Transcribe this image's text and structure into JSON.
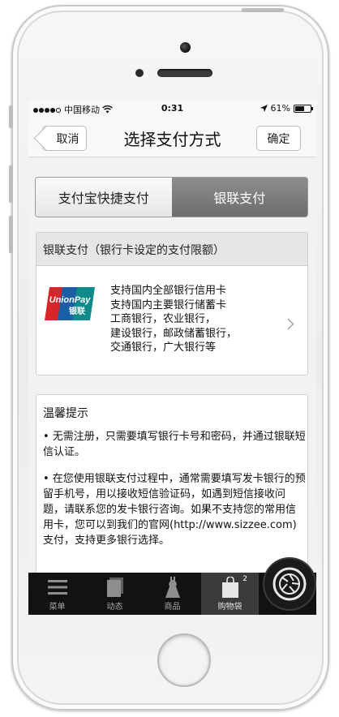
{
  "status_bar": {
    "carrier": "中国移动",
    "time": "0:31",
    "battery": "61%",
    "battery_level": 0.61
  },
  "nav": {
    "back_label": "取消",
    "title": "选择支付方式",
    "confirm_label": "确定"
  },
  "payment_tabs": [
    {
      "label": "支付宝快捷支付",
      "selected": false
    },
    {
      "label": "银联支付",
      "selected": true
    }
  ],
  "unionpay_card": {
    "header": "银联支付（银行卡设定的支付限额）",
    "logo_text": "UnionPay",
    "logo_text_cn": "银联",
    "lines": [
      "支持国内全部银行信用卡",
      "支持国内主要银行储蓄卡",
      "工商银行，农业银行，",
      "建设银行，邮政储蓄银行，",
      "交通银行，广大银行等"
    ]
  },
  "tips": {
    "title": "温馨提示",
    "paragraphs": [
      "• 无需注册，只需要填写银行卡号和密码，并通过银联短信认证。",
      "• 在您使用银联支付过程中，通常需要填写发卡银行的预留手机号，用以接收短信验证码，如遇到短信接收问题，请联系您的发卡银行咨询。如果不支持您的常用信用卡，您可以到我们的官网(http://www.sizzee.com)支付，支持更多银行选择。"
    ]
  },
  "tab_bar": {
    "items": [
      {
        "label": "菜单",
        "icon": "menu-icon"
      },
      {
        "label": "动态",
        "icon": "feed-icon"
      },
      {
        "label": "商品",
        "icon": "dress-icon"
      },
      {
        "label": "购物袋",
        "icon": "shopping-bag-icon",
        "badge": "2",
        "active": true
      },
      {
        "label": "",
        "icon": "camera-shutter-icon"
      }
    ]
  },
  "colors": {
    "segment_active": "#7e7b7b",
    "tab_bar": "#121212",
    "unionpay_red": "#d7262a",
    "unionpay_blue": "#1a5fa6",
    "unionpay_teal": "#0e8a8a"
  }
}
